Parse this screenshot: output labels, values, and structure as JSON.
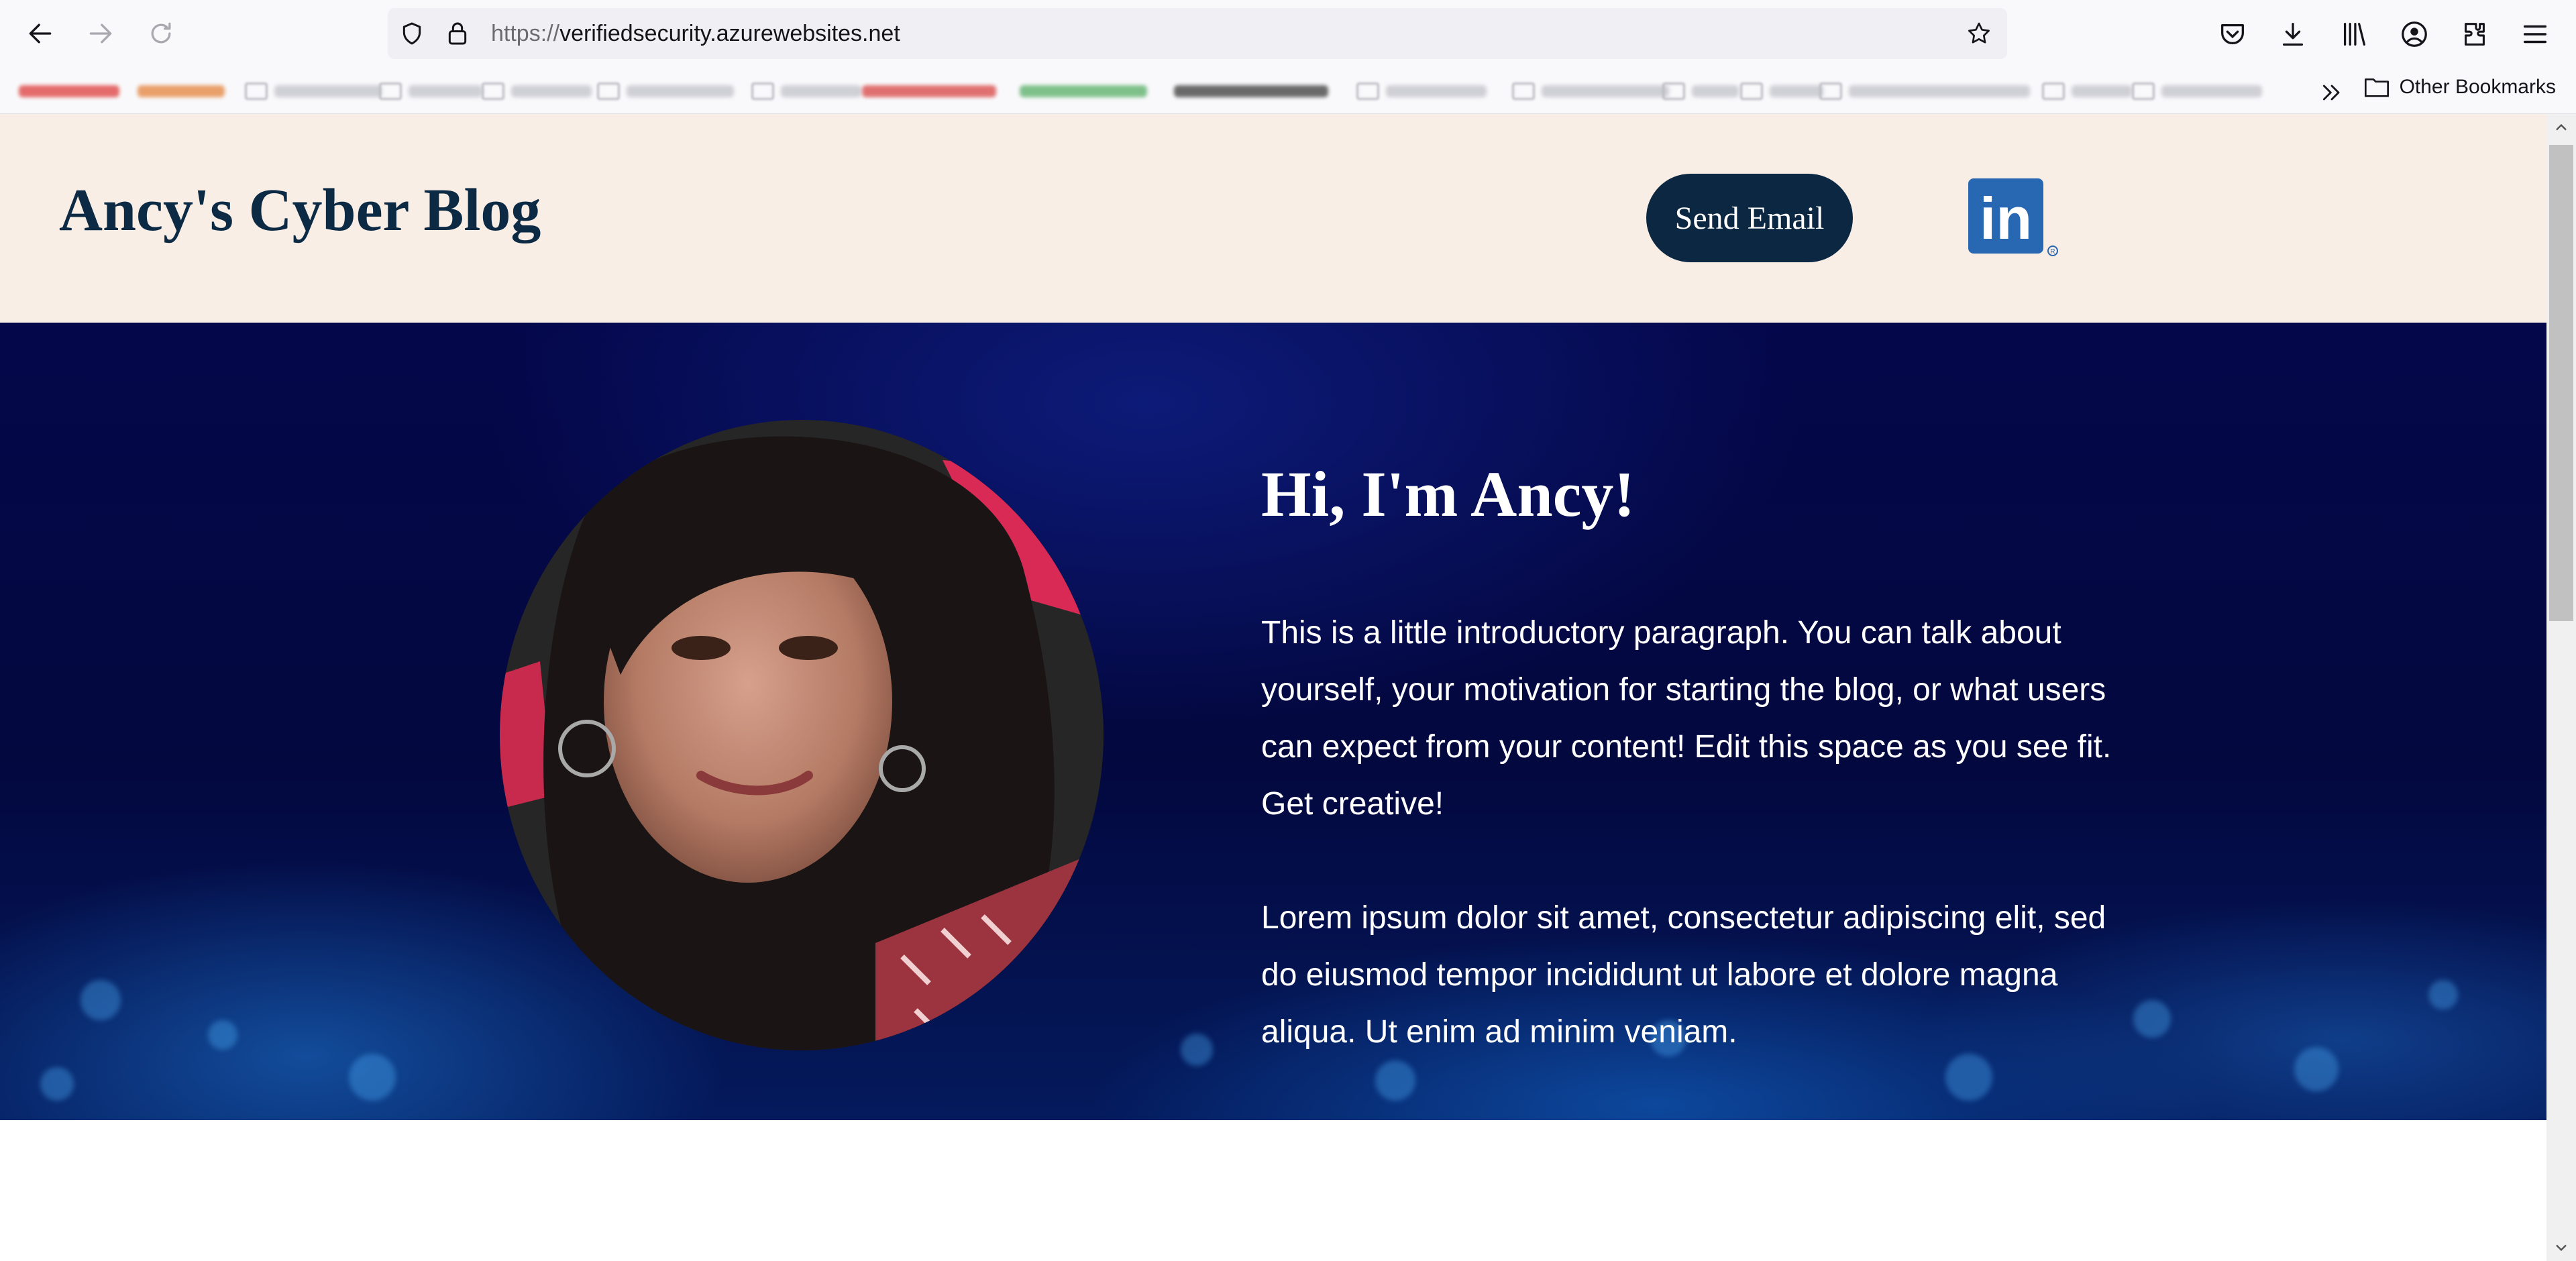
{
  "browser": {
    "url_scheme": "https://",
    "url_host": "verifiedsecurity.azurewebsites.net",
    "other_bookmarks_label": "Other Bookmarks"
  },
  "site": {
    "title": "Ancy's Cyber Blog",
    "send_email_label": "Send Email",
    "linkedin_logo_text": "in",
    "colors": {
      "header_bg": "#f8eee5",
      "title": "#0d2a45",
      "button_bg": "#0b2742",
      "linkedin": "#2867b2",
      "hero_bg": "#03083f"
    }
  },
  "hero": {
    "heading": "Hi, I'm Ancy!",
    "paragraph1": "This is a little introductory paragraph. You can talk about yourself, your motivation for starting the blog, or what users can expect from your content! Edit this space as you see fit. Get creative!",
    "paragraph2": "Lorem ipsum dolor sit amet, consectetur adipiscing elit, sed do eiusmod tempor incididunt ut labore et dolore magna aliqua. Ut enim ad minim veniam."
  }
}
